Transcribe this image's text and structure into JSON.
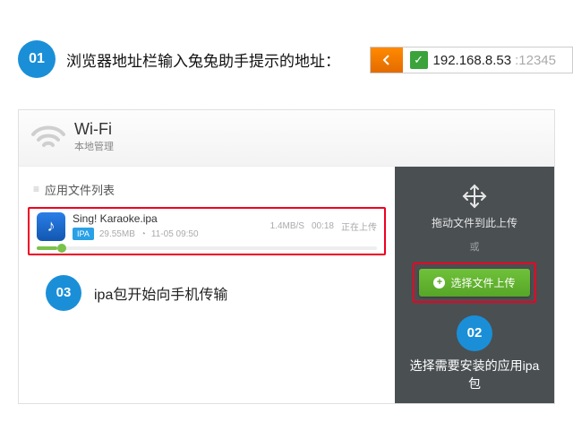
{
  "step1": {
    "num": "01",
    "text": "浏览器地址栏输入兔兔助手提示的地址："
  },
  "address": {
    "ip": "192.168.8.53",
    "port": ":12345"
  },
  "wifi": {
    "title": "Wi-Fi",
    "subtitle": "本地管理"
  },
  "list": {
    "header": "应用文件列表"
  },
  "file": {
    "name": "Sing! Karaoke.ipa",
    "tag": "IPA",
    "size": "29.55MB",
    "time": "11-05 09:50",
    "speed": "1.4MB/S",
    "elapsed": "00:18",
    "status": "正在上传"
  },
  "step3": {
    "num": "03",
    "text": "ipa包开始向手机传输"
  },
  "drop": {
    "drag": "拖动文件到此上传",
    "or": "或",
    "btn": "选择文件上传"
  },
  "step2": {
    "num": "02",
    "text": "选择需要安装的应用ipa包"
  }
}
